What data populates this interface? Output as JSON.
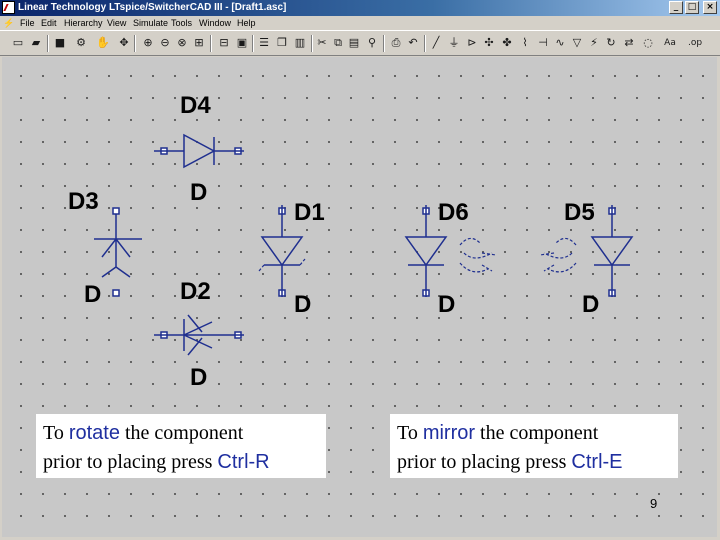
{
  "window": {
    "title": "Linear Technology LTspice/SwitcherCAD III - [Draft1.asc]",
    "buttons": [
      {
        "name": "minimize-button",
        "glyph": "_"
      },
      {
        "name": "maximize-button",
        "glyph": "□"
      },
      {
        "name": "close-button",
        "glyph": "×"
      }
    ]
  },
  "menu": [
    "File",
    "Edit",
    "Hierarchy",
    "View",
    "Simulate",
    "Tools",
    "Window",
    "Help"
  ],
  "toolbar": {
    "buttons": [
      {
        "name": "new-schematic-icon",
        "glyph": "▭"
      },
      {
        "name": "open-icon",
        "glyph": "▰"
      },
      {
        "name": "save-icon",
        "glyph": "■"
      },
      {
        "name": "control-panel-icon",
        "glyph": "⚙"
      },
      {
        "name": "halt-icon",
        "glyph": "✋"
      },
      {
        "name": "zoom-in-icon",
        "glyph": "⊕"
      },
      {
        "name": "pan-icon",
        "glyph": "✥"
      },
      {
        "name": "zoom-out-icon",
        "glyph": "⊖"
      },
      {
        "name": "zoom-fit-icon",
        "glyph": "⊗"
      },
      {
        "name": "autoscale-icon",
        "glyph": "⊞"
      },
      {
        "name": "waveform-icon",
        "glyph": "⊟"
      },
      {
        "name": "tile-horizontal-icon",
        "glyph": "☰"
      },
      {
        "name": "cascade-icon",
        "glyph": "❐"
      },
      {
        "name": "tile-vertical-icon",
        "glyph": "▥"
      },
      {
        "name": "cut-icon",
        "glyph": "✂"
      },
      {
        "name": "copy-icon",
        "glyph": "⧉"
      },
      {
        "name": "paste-icon",
        "glyph": "▤"
      },
      {
        "name": "find-icon",
        "glyph": "⚲"
      },
      {
        "name": "print-icon",
        "glyph": "⎙"
      },
      {
        "name": "print-preview-icon",
        "glyph": "▣"
      },
      {
        "name": "undo-icon",
        "glyph": "↶"
      },
      {
        "name": "wire-icon",
        "glyph": "╱"
      },
      {
        "name": "ground-icon",
        "glyph": "⏚"
      },
      {
        "name": "label-net-icon",
        "glyph": "⊳"
      },
      {
        "name": "move-icon",
        "glyph": "✣"
      },
      {
        "name": "drag-icon",
        "glyph": "✤"
      },
      {
        "name": "resistor-icon",
        "glyph": "⌇"
      },
      {
        "name": "capacitor-icon",
        "glyph": "⊣"
      },
      {
        "name": "inductor-icon",
        "glyph": "∿"
      },
      {
        "name": "diode-icon",
        "glyph": "▽"
      },
      {
        "name": "component-icon",
        "glyph": "⚡"
      },
      {
        "name": "rotate-icon",
        "glyph": "↻"
      },
      {
        "name": "mirror-icon",
        "glyph": "⇄"
      },
      {
        "name": "spice-directive-icon",
        "glyph": "◌"
      },
      {
        "name": "text-icon",
        "glyph": "Aa"
      },
      {
        "name": "op-icon",
        "glyph": ".op"
      }
    ]
  },
  "schematic": {
    "components": [
      {
        "name": "diode-d4",
        "ref": "D4",
        "value": "D"
      },
      {
        "name": "diode-d3",
        "ref": "D3",
        "value": "D"
      },
      {
        "name": "diode-d2",
        "ref": "D2",
        "value": "D"
      },
      {
        "name": "diode-d1",
        "ref": "D1",
        "value": "D"
      },
      {
        "name": "diode-d6",
        "ref": "D6",
        "value": "D"
      },
      {
        "name": "diode-d5",
        "ref": "D5",
        "value": "D"
      }
    ]
  },
  "notes": {
    "rotate": {
      "pre": "To ",
      "keyword": "rotate",
      "mid": " the component",
      "line2": "prior to placing press ",
      "key": "Ctrl-R"
    },
    "mirror": {
      "pre": "To ",
      "keyword": "mirror",
      "mid": " the component",
      "line2": "prior to placing press ",
      "key": "Ctrl-E"
    }
  },
  "slide_number": "9",
  "colors": {
    "title_bar": "#0a246a",
    "canvas": "#c8c8c8",
    "wire": "#1f2f8f",
    "keyword": "#1f2fa0"
  }
}
